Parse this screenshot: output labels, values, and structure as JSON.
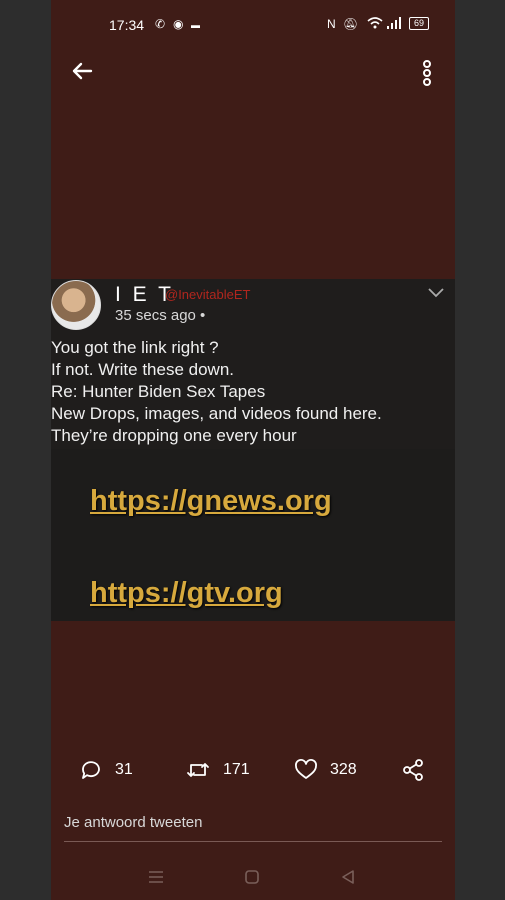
{
  "status_bar": {
    "time": "17:34",
    "battery": "69",
    "icons": [
      "whatsapp-icon",
      "spotify-icon",
      "notification-icon",
      "nfc-icon",
      "mute-icon",
      "wifi-icon",
      "signal-icon",
      "battery-icon"
    ]
  },
  "tweet": {
    "display_name": "I E T",
    "handle": "@InevitableET",
    "timestamp": "35 secs ago •",
    "lines": [
      "You got the link right ?",
      "If not. Write these down.",
      "Re: Hunter Biden Sex Tapes",
      "New Drops, images, and videos found here.",
      "They’re dropping one every hour"
    ],
    "links": [
      "https://gnews.org",
      "https://gtv.org"
    ]
  },
  "actions": {
    "replies": "31",
    "retweets": "171",
    "likes": "328"
  },
  "reply_placeholder": "Je antwoord tweeten",
  "colors": {
    "background": "#3f1c17",
    "handle": "#b0261e",
    "link": "#d7a93d"
  }
}
